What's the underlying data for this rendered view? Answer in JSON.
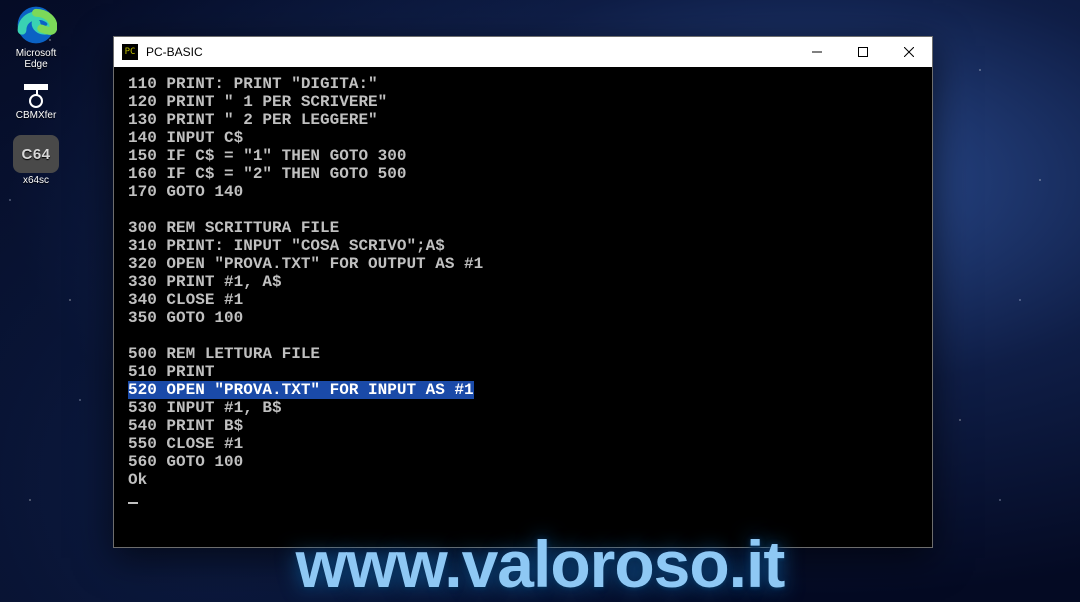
{
  "desktop_icons": [
    {
      "id": "edge",
      "label": "Microsoft Edge"
    },
    {
      "id": "cbmxfer",
      "label": "CBMXfer"
    },
    {
      "id": "x64sc",
      "label": "x64sc",
      "badge": "C64"
    }
  ],
  "window": {
    "title": "PC-BASIC",
    "controls": {
      "min": "—",
      "max": "▢",
      "close": "✕"
    }
  },
  "terminal": {
    "lines": [
      "110 PRINT: PRINT \"DIGITA:\"",
      "120 PRINT \" 1 PER SCRIVERE\"",
      "130 PRINT \" 2 PER LEGGERE\"",
      "140 INPUT C$",
      "150 IF C$ = \"1\" THEN GOTO 300",
      "160 IF C$ = \"2\" THEN GOTO 500",
      "170 GOTO 140",
      "",
      "300 REM SCRITTURA FILE",
      "310 PRINT: INPUT \"COSA SCRIVO\";A$",
      "320 OPEN \"PROVA.TXT\" FOR OUTPUT AS #1",
      "330 PRINT #1, A$",
      "340 CLOSE #1",
      "350 GOTO 100",
      "",
      "500 REM LETTURA FILE",
      "510 PRINT"
    ],
    "highlighted_line": "520 OPEN \"PROVA.TXT\" FOR INPUT AS #1",
    "lines_after": [
      "530 INPUT #1, B$",
      "540 PRINT B$",
      "550 CLOSE #1",
      "560 GOTO 100",
      "Ok"
    ],
    "app_icon_text": "PC"
  },
  "watermark": "www.valoroso.it"
}
